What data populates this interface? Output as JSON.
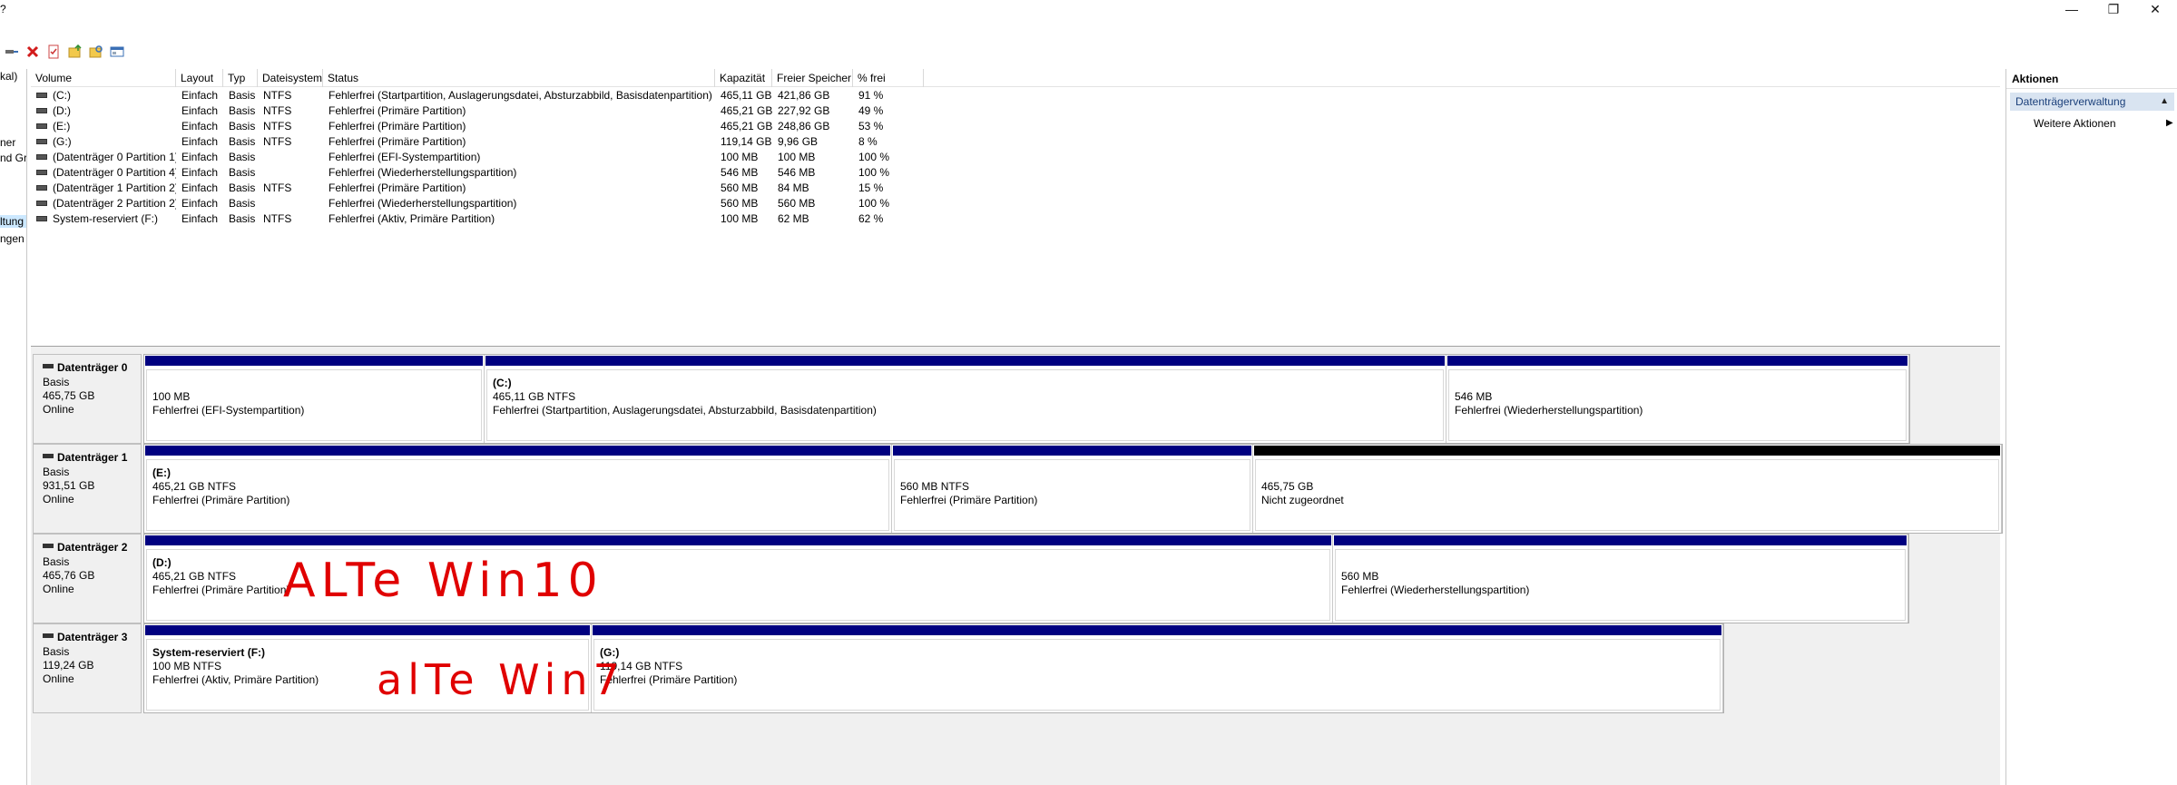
{
  "titlebar": {
    "question_fragment": "?",
    "minimize_glyph": "—",
    "restore_glyph": "❐",
    "close_glyph": "✕"
  },
  "toolbar": {
    "icons": [
      "connect-icon",
      "delete-icon",
      "checklist-icon",
      "folder-up-icon",
      "folder-search-icon",
      "window-icon"
    ]
  },
  "left_panel": {
    "fragments": [
      "kal)",
      "ner",
      "nd Gr",
      "ltung",
      "ngen"
    ]
  },
  "volume_table": {
    "columns": [
      "Volume",
      "Layout",
      "Typ",
      "Dateisystem",
      "Status",
      "Kapazität",
      "Freier Speicher",
      "% frei"
    ],
    "rows": [
      [
        "(C:)",
        "Einfach",
        "Basis",
        "NTFS",
        "Fehlerfrei (Startpartition, Auslagerungsdatei, Absturzabbild, Basisdatenpartition)",
        "465,11 GB",
        "421,86 GB",
        "91 %"
      ],
      [
        "(D:)",
        "Einfach",
        "Basis",
        "NTFS",
        "Fehlerfrei (Primäre Partition)",
        "465,21 GB",
        "227,92 GB",
        "49 %"
      ],
      [
        "(E:)",
        "Einfach",
        "Basis",
        "NTFS",
        "Fehlerfrei (Primäre Partition)",
        "465,21 GB",
        "248,86 GB",
        "53 %"
      ],
      [
        "(G:)",
        "Einfach",
        "Basis",
        "NTFS",
        "Fehlerfrei (Primäre Partition)",
        "119,14 GB",
        "9,96 GB",
        "8 %"
      ],
      [
        "(Datenträger 0 Partition 1)",
        "Einfach",
        "Basis",
        "",
        "Fehlerfrei (EFI-Systempartition)",
        "100 MB",
        "100 MB",
        "100 %"
      ],
      [
        "(Datenträger 0 Partition 4)",
        "Einfach",
        "Basis",
        "",
        "Fehlerfrei (Wiederherstellungspartition)",
        "546 MB",
        "546 MB",
        "100 %"
      ],
      [
        "(Datenträger 1 Partition 2)",
        "Einfach",
        "Basis",
        "NTFS",
        "Fehlerfrei (Primäre Partition)",
        "560 MB",
        "84 MB",
        "15 %"
      ],
      [
        "(Datenträger 2 Partition 2)",
        "Einfach",
        "Basis",
        "",
        "Fehlerfrei (Wiederherstellungspartition)",
        "560 MB",
        "560 MB",
        "100 %"
      ],
      [
        "System-reserviert (F:)",
        "Einfach",
        "Basis",
        "NTFS",
        "Fehlerfrei (Aktiv, Primäre Partition)",
        "100 MB",
        "62 MB",
        "62 %"
      ]
    ]
  },
  "disks": [
    {
      "name": "Datenträger 0",
      "type": "Basis",
      "size": "465,75 GB",
      "state": "Online",
      "partitions": [
        {
          "name": "",
          "size": "100 MB",
          "status": "Fehlerfrei (EFI-Systempartition)",
          "allocated": true
        },
        {
          "name": "(C:)",
          "size": "465,11 GB NTFS",
          "status": "Fehlerfrei (Startpartition, Auslagerungsdatei, Absturzabbild, Basisdatenpartition)",
          "allocated": true
        },
        {
          "name": "",
          "size": "546 MB",
          "status": "Fehlerfrei (Wiederherstellungspartition)",
          "allocated": true
        }
      ]
    },
    {
      "name": "Datenträger 1",
      "type": "Basis",
      "size": "931,51 GB",
      "state": "Online",
      "partitions": [
        {
          "name": "(E:)",
          "size": "465,21 GB NTFS",
          "status": "Fehlerfrei (Primäre Partition)",
          "allocated": true
        },
        {
          "name": "",
          "size": "560 MB NTFS",
          "status": "Fehlerfrei (Primäre Partition)",
          "allocated": true
        },
        {
          "name": "",
          "size": "465,75 GB",
          "status": "Nicht zugeordnet",
          "allocated": false
        }
      ]
    },
    {
      "name": "Datenträger 2",
      "type": "Basis",
      "size": "465,76 GB",
      "state": "Online",
      "partitions": [
        {
          "name": "(D:)",
          "size": "465,21 GB NTFS",
          "status": "Fehlerfrei (Primäre Partition)",
          "allocated": true
        },
        {
          "name": "",
          "size": "560 MB",
          "status": "Fehlerfrei (Wiederherstellungspartition)",
          "allocated": true
        }
      ]
    },
    {
      "name": "Datenträger 3",
      "type": "Basis",
      "size": "119,24 GB",
      "state": "Online",
      "partitions": [
        {
          "name": "System-reserviert  (F:)",
          "size": "100 MB NTFS",
          "status": "Fehlerfrei (Aktiv, Primäre Partition)",
          "allocated": true
        },
        {
          "name": "(G:)",
          "size": "119,14 GB NTFS",
          "status": "Fehlerfrei (Primäre Partition)",
          "allocated": true
        }
      ]
    }
  ],
  "annotations": {
    "win10": "ALTe Win10",
    "win7": "alTe Win7"
  },
  "actions_panel": {
    "header": "Aktionen",
    "section": "Datenträgerverwaltung",
    "item": "Weitere Aktionen"
  },
  "colors": {
    "allocated_bar": "#000080",
    "unallocated_bar": "#000000",
    "annotation_red": "#e00000",
    "selection": "#cce8ff"
  }
}
